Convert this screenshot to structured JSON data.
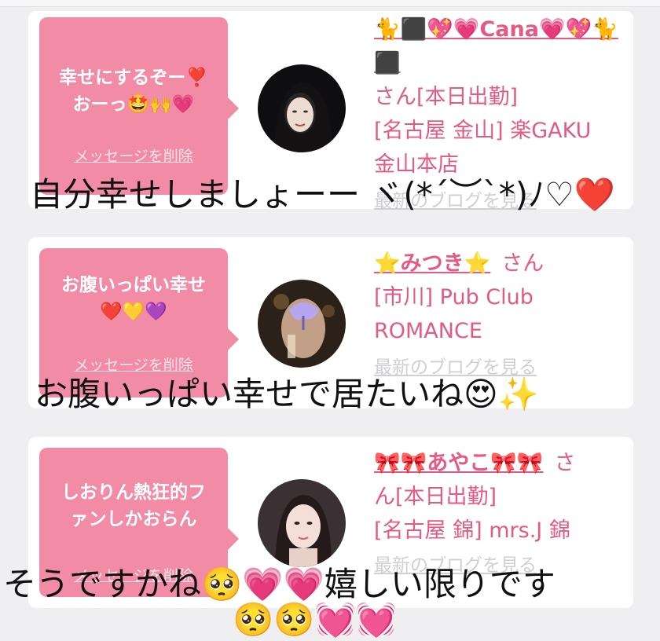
{
  "cards": [
    {
      "message_line1": "幸せにするぞー❣️",
      "message_line2": "おーっ🤩🙌💗",
      "delete_label": "メッセージを削除",
      "cast_name": "🐈⬛💖💗Cana💗💖🐈⬛",
      "san": "さん[本日出勤]",
      "shop_area": "[名古屋 金山] 楽GAKU",
      "shop_name": "金山本店",
      "blog_label": "最新のブログを見る"
    },
    {
      "message_line1": "お腹いっぱい幸せ",
      "message_line2": "❤️💛💜",
      "delete_label": "メッセージを削除",
      "cast_name": "⭐️みつき⭐️",
      "san": "さん",
      "shop_area": "[市川] Pub Club",
      "shop_name": "ROMANCE",
      "blog_label": "最新のブログを見る"
    },
    {
      "message_line1": "しおりん熱狂的フ",
      "message_line2": "ァンしかおらん",
      "delete_label": "メッセージを削除",
      "cast_name": "🎀🎀あやこ🎀🎀",
      "san": "さ",
      "san_cont": "ん[本日出勤]",
      "shop_area": "[名古屋 錦] mrs.J 錦",
      "blog_label": "最新のブログを見る"
    }
  ],
  "captions": {
    "caption1": "自分幸せしましょーー ヾ(*´︶`*)ﾉ♡❤️",
    "caption2": "お腹いっぱい幸せで居たいね😍✨",
    "caption3a": "そうですかね🥺💗💗嬉しい限りです",
    "caption3b": "🥺🥺💓💓"
  }
}
